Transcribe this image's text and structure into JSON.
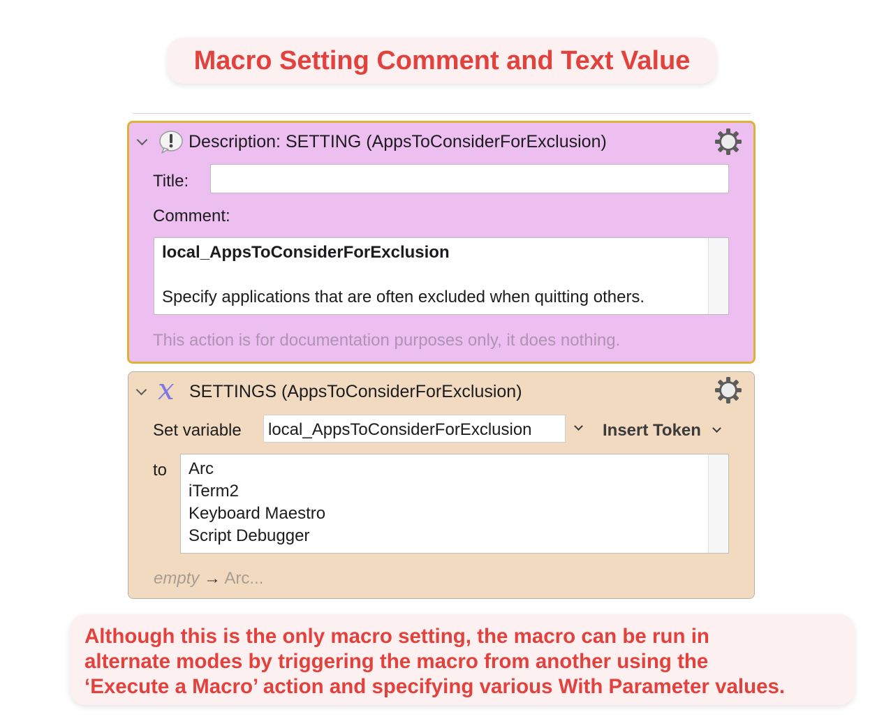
{
  "callouts": {
    "top_title": "Macro Setting Comment and Text Value",
    "bottom_note": [
      "Although this is the only macro setting, the macro can be run in",
      "alternate modes by triggering the macro from another using the",
      "‘Execute a Macro’ action and specifying various With Parameter values."
    ]
  },
  "colors": {
    "callout_text": "#e2423e",
    "callout_bg": "#fcf0f0",
    "description_bg": "#ecbff0",
    "description_border": "#ddb23a",
    "settings_bg": "#f1dac0",
    "variable_icon": "#7c78e4"
  },
  "description_action": {
    "header": "Description: SETTING (AppsToConsiderForExclusion)",
    "icon": "exclamation-bubble-icon",
    "title_label": "Title:",
    "title_value": "",
    "comment_label": "Comment:",
    "comment_heading": "local_AppsToConsiderForExclusion",
    "comment_body": "Specify applications that are often excluded when quitting others.",
    "footer_note": "This action is for documentation purposes only, it does nothing."
  },
  "settings_action": {
    "header": "SETTINGS (AppsToConsiderForExclusion)",
    "icon": "variable-x-icon",
    "icon_glyph": "𝑥",
    "set_variable_label": "Set variable",
    "variable_name": "local_AppsToConsiderForExclusion",
    "insert_token_label": "Insert Token",
    "to_label": "to",
    "value_lines": [
      "Arc",
      "iTerm2",
      "Keyboard Maestro",
      "Script Debugger"
    ],
    "summary_before": "empty",
    "summary_arrow": "→",
    "summary_after": "Arc..."
  }
}
